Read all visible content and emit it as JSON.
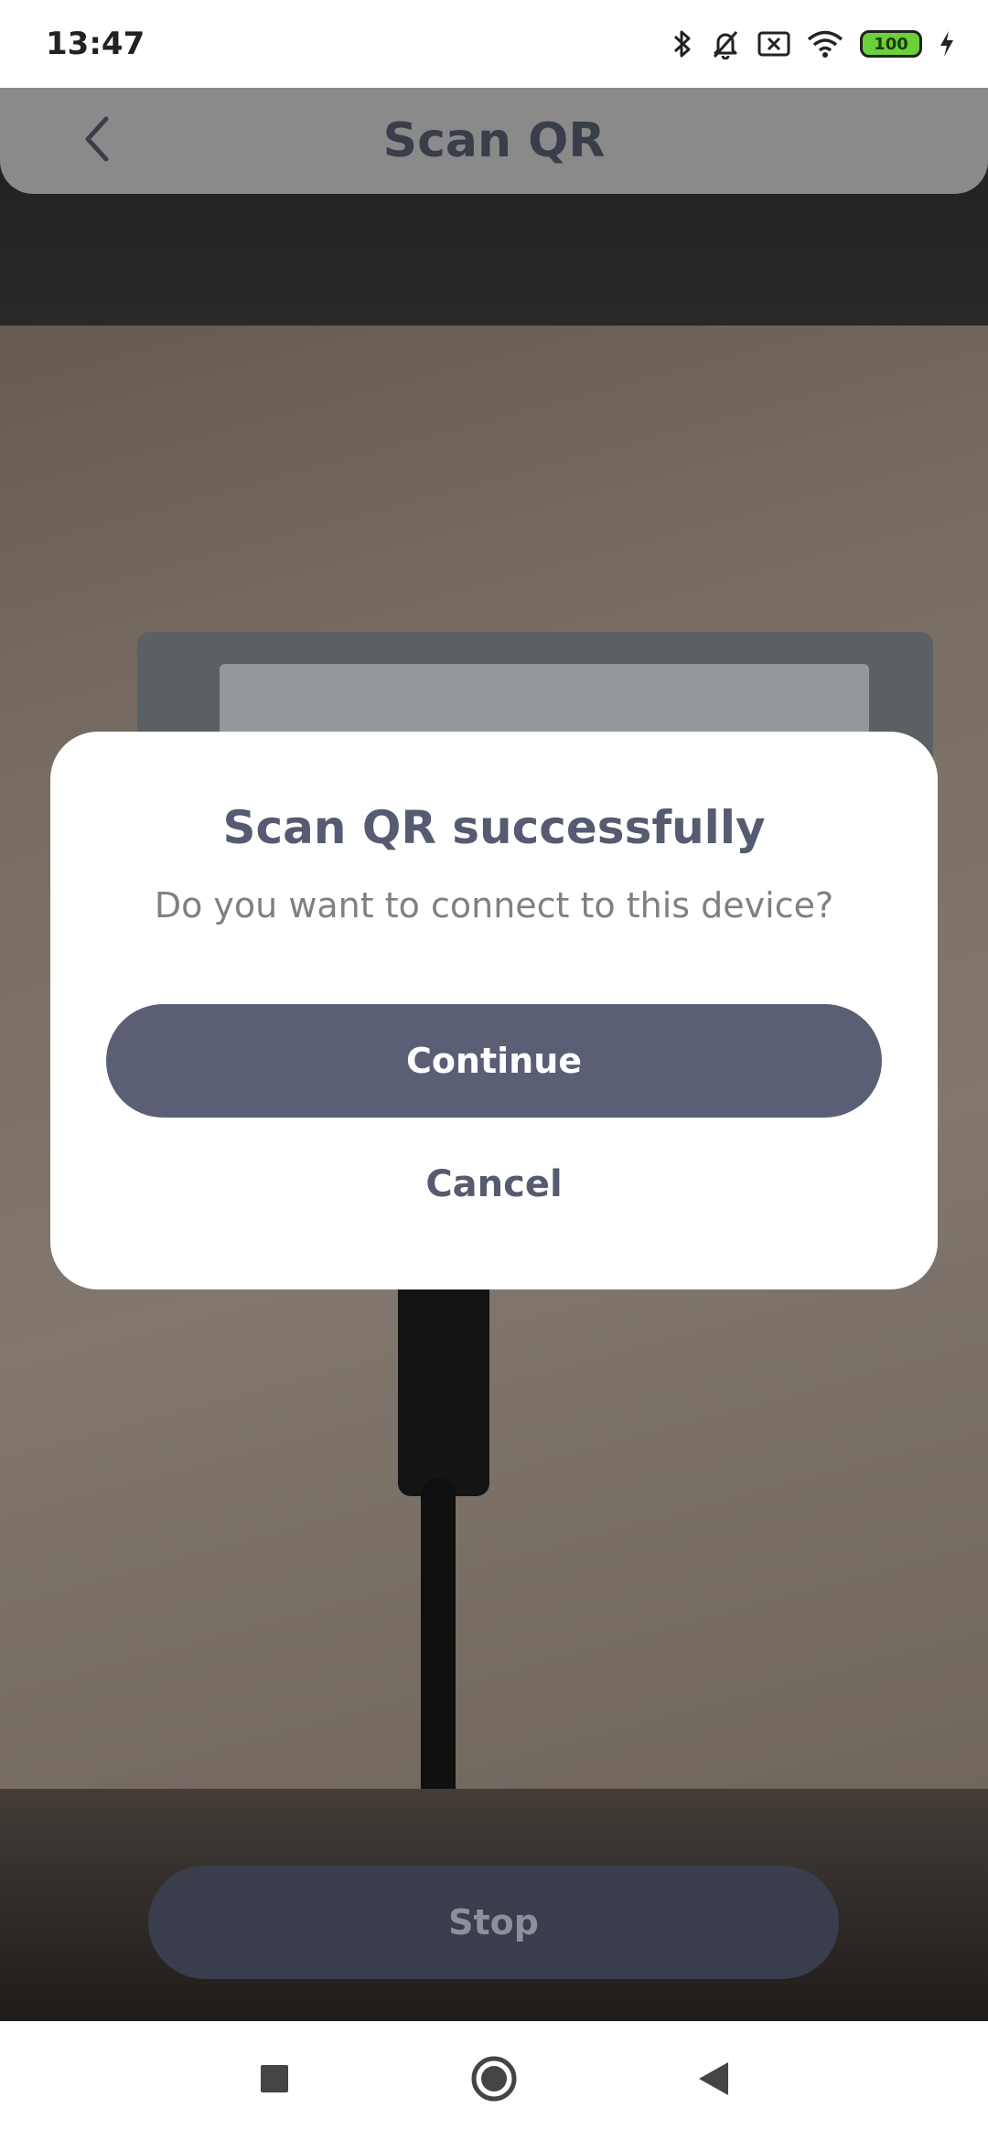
{
  "status_bar": {
    "time": "13:47",
    "battery_level": "100",
    "icons": [
      "bluetooth-icon",
      "bell-off-icon",
      "sim-off-icon",
      "wifi-icon",
      "battery-icon",
      "charging-icon"
    ]
  },
  "header": {
    "title": "Scan QR",
    "back_icon": "chevron-left-icon"
  },
  "dialog": {
    "title": "Scan QR successfully",
    "message": "Do you want to connect to this device?",
    "continue_label": "Continue",
    "cancel_label": "Cancel"
  },
  "footer": {
    "stop_label": "Stop"
  },
  "nav_bar": {
    "icons": [
      "recent-apps-icon",
      "home-icon",
      "back-icon"
    ]
  },
  "colors": {
    "primary": "#5a5f76",
    "title_text": "#555b70",
    "stop_button": "#3a3d4c"
  }
}
